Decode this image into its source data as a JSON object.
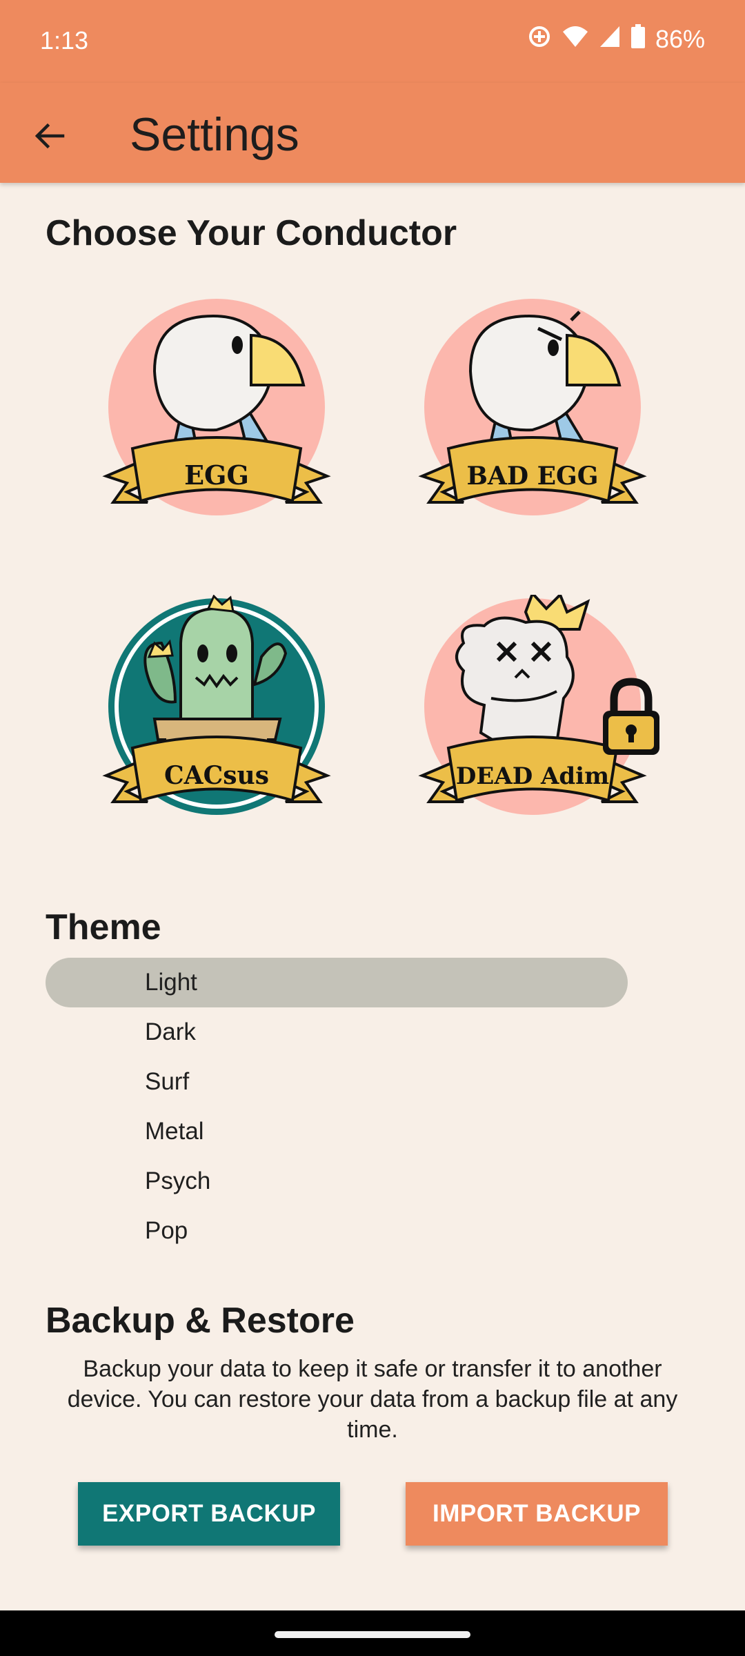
{
  "status": {
    "time": "1:13",
    "battery": "86%"
  },
  "appbar": {
    "title": "Settings"
  },
  "conductors": {
    "heading": "Choose Your Conductor",
    "items": [
      {
        "label": "EGG",
        "locked": false
      },
      {
        "label": "BAD EGG",
        "locked": false
      },
      {
        "label": "CACsus",
        "locked": false
      },
      {
        "label": "DEAD Adim",
        "locked": true
      }
    ]
  },
  "theme": {
    "heading": "Theme",
    "options": [
      "Light",
      "Dark",
      "Surf",
      "Metal",
      "Psych",
      "Pop"
    ],
    "selected": "Light"
  },
  "backup": {
    "heading": "Backup & Restore",
    "description": "Backup your data to keep it safe or transfer it to another device. You can restore your data from a backup file at any time.",
    "export_label": "EXPORT BACKUP",
    "import_label": "IMPORT BACKUP"
  },
  "colors": {
    "accent": "#ee8a5e",
    "teal": "#107775",
    "background": "#f8efe7",
    "selected_theme": "#c4c2b8"
  }
}
